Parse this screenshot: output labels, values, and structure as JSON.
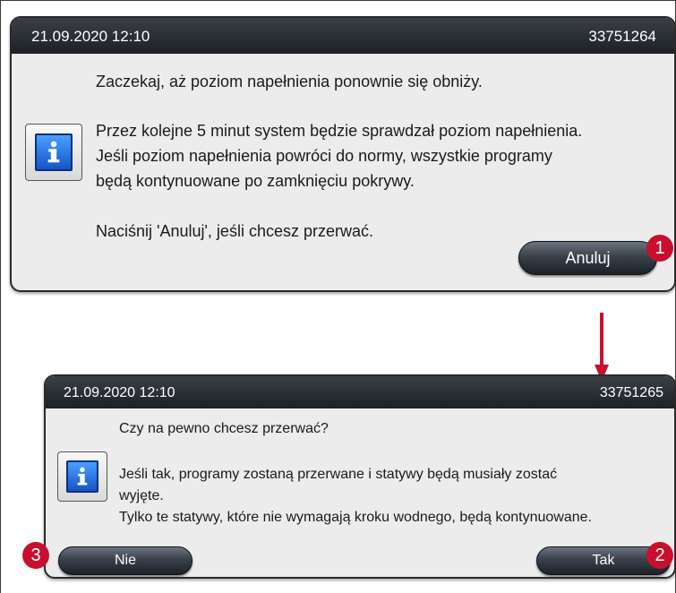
{
  "dialog1": {
    "datetime": "21.09.2020 12:10",
    "id": "33751264",
    "lines": [
      "Zaczekaj, aż poziom napełnienia ponownie się obniży.",
      "Przez kolejne 5 minut system będzie sprawdzał poziom napełnienia.",
      "Jeśli poziom napełnienia powróci do normy, wszystkie programy",
      "będą kontynuowane po zamknięciu pokrywy.",
      "Naciśnij 'Anuluj', jeśli chcesz przerwać."
    ],
    "cancel_label": "Anuluj",
    "marker": "1"
  },
  "dialog2": {
    "datetime": "21.09.2020 12:10",
    "id": "33751265",
    "lines": [
      "Czy na pewno chcesz przerwać?",
      "Jeśli tak, programy zostaną przerwane i statywy będą musiały zostać",
      "wyjęte.",
      "Tylko te statywy, które nie wymagają kroku wodnego, będą kontynuowane."
    ],
    "no_label": "Nie",
    "yes_label": "Tak",
    "marker_yes": "2",
    "marker_no": "3"
  },
  "colors": {
    "marker": "#c8102e",
    "titlebar": "#1d2127",
    "info_icon": "#1454c8"
  },
  "icons": {
    "info": "info-icon",
    "arrow": "down-arrow-icon"
  }
}
